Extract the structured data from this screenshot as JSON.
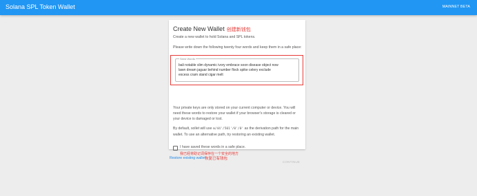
{
  "appbar": {
    "title": "Solana SPL Token Wallet",
    "network_button": "MAINNET BETA"
  },
  "card": {
    "title": "Create New Wallet",
    "title_annotation": "创建新钱包",
    "intro": "Create a new wallet to hold Solana and SPL tokens.",
    "instruction": "Please write down the following twenty four words and keep them in a safe place:",
    "seed_field_label": "Seed Words",
    "seed_words": "bali notable slim dynamic ivory embrace soon disease object now\nlawn dream jaguar behind number flock spike celery exclude\nexcess cram stand cigar melt",
    "private_keys_note": "Your private keys are only stored on your current computer or device. You will need these words to restore your wallet if your browser's storage is cleared or your device is damaged or lost.",
    "derivation_prefix": "By default, sollet will use ",
    "derivation_path": "m/44'/501'/0'/0'",
    "derivation_suffix": " as the derivation path for the main wallet. To use an alternative path, try restoring an existing wallet.",
    "checkbox_label": "I have saved these words in a safe place.",
    "checkbox_annotation": "我已经将助记词保存在一个安全的地方",
    "continue_button": "CONTINUE",
    "annotation_color": "#e53935",
    "arrow_color": "#2e7d32"
  },
  "footer": {
    "restore_link": "Restore existing wallet",
    "restore_annotation": "恢复已有钱包"
  }
}
